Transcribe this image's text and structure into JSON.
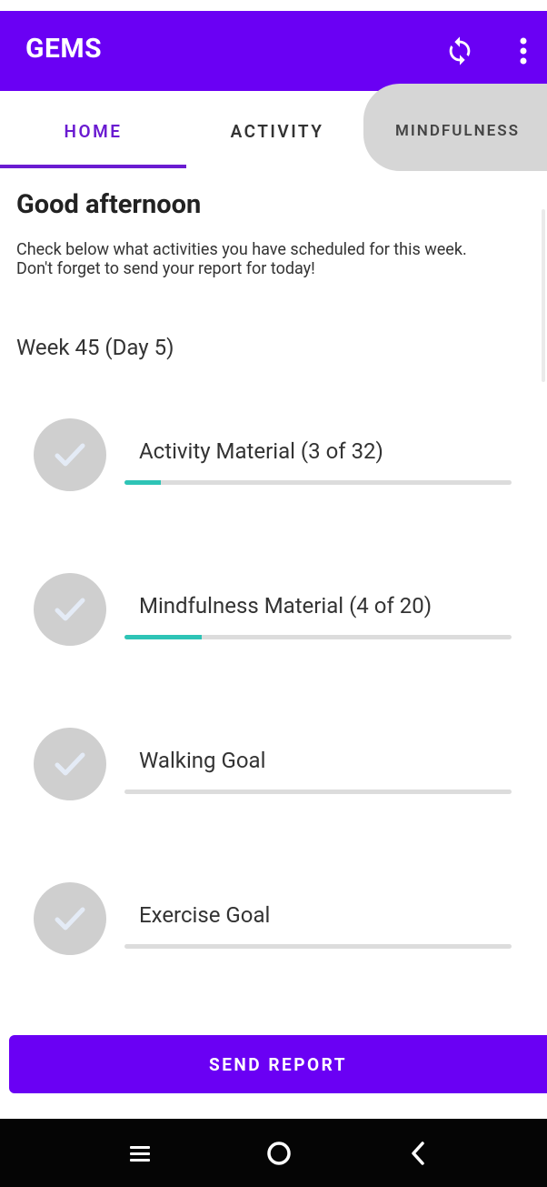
{
  "app": {
    "title": "GEMS",
    "icons": {
      "sync": "sync-icon",
      "more": "more-vertical-icon"
    },
    "colors": {
      "primary": "#6a00f4",
      "accent": "#2ec4b6",
      "check_bg": "#cfcfcf"
    }
  },
  "tabs": [
    {
      "label": "HOME",
      "selected": true
    },
    {
      "label": "ACTIVITY",
      "selected": false
    },
    {
      "label": "MINDFULNESS",
      "selected": false
    }
  ],
  "home": {
    "greeting": "Good afternoon",
    "desc_line1": "Check below what activities you have scheduled for this week.",
    "desc_line2": "Don't forget to send your report for today!",
    "week": "Week 45 (Day 5)"
  },
  "tasks": [
    {
      "label": "Activity Material (3 of 32)",
      "progress": 0.094
    },
    {
      "label": "Mindfulness Material (4 of 20)",
      "progress": 0.2
    },
    {
      "label": "Walking Goal",
      "progress": 0
    },
    {
      "label": "Exercise Goal",
      "progress": 0
    }
  ],
  "send_button": {
    "label": "SEND REPORT"
  },
  "system_nav": {
    "icons": [
      "recents-icon",
      "home-circle-icon",
      "back-icon"
    ]
  }
}
